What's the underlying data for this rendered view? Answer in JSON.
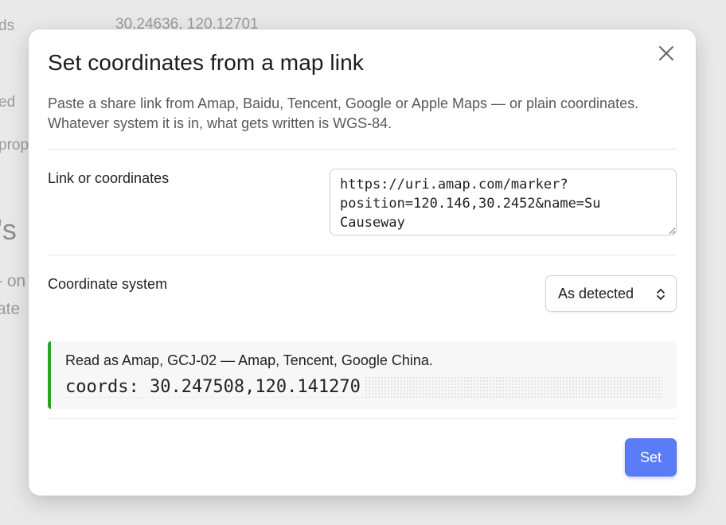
{
  "background": {
    "coords_label_fragment": "ds",
    "coords_value": "30.24636, 120.12701",
    "fragment_ed": "ed",
    "fragment_prop": "prop",
    "heading_fragment": "'s",
    "line_fragment_1": "- on",
    "line_fragment_2": "ate"
  },
  "dialog": {
    "title": "Set coordinates from a map link",
    "description": "Paste a share link from Amap, Baidu, Tencent, Google or Apple Maps — or plain coordinates. Whatever system it is in, what gets written is WGS-84.",
    "close_icon": "close-icon",
    "link_field": {
      "label": "Link or coordinates",
      "value": "https://uri.amap.com/marker?position=120.146,30.2452&name=Su Causeway"
    },
    "system_field": {
      "label": "Coordinate system",
      "selected": "As detected",
      "caret_icon": "chevron-up-down-icon"
    },
    "result": {
      "detected_text": "Read as Amap, GCJ-02 — Amap, Tencent, Google China.",
      "coords_text": "coords: 30.247508,120.141270",
      "accent_color": "#2ca22c"
    },
    "set_label": "Set",
    "primary_color": "#5b7cf7"
  }
}
